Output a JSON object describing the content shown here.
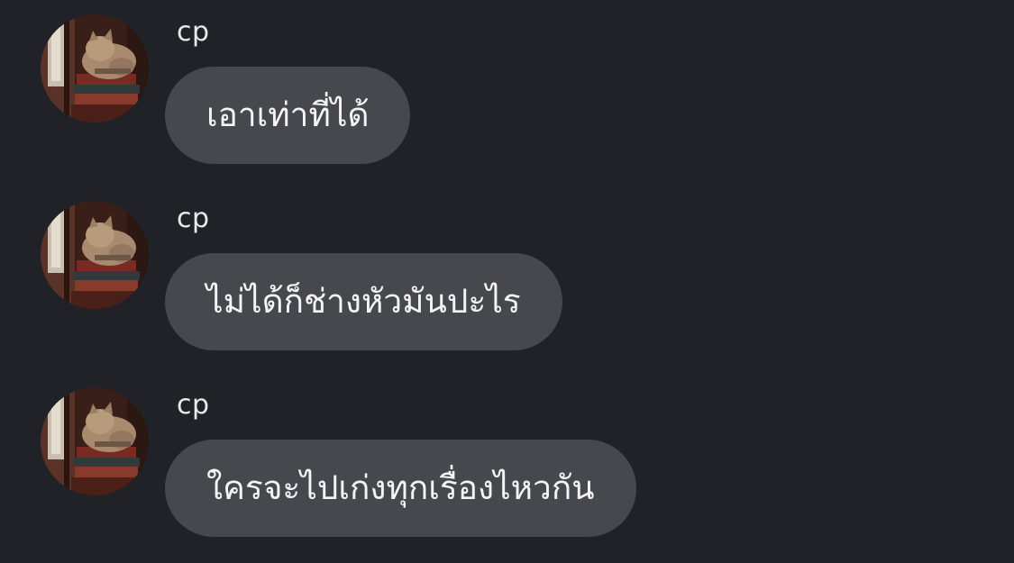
{
  "messages": [
    {
      "sender": "cp",
      "text": "เอาเท่าที่ได้"
    },
    {
      "sender": "cp",
      "text": "ไม่ได้ก็ช่างหัวมันปะไร"
    },
    {
      "sender": "cp",
      "text": "ใครจะไปเก่งทุกเรื่องไหวกัน"
    }
  ],
  "colors": {
    "background": "#212227",
    "bubble": "#47484e",
    "text": "#f4f4f6"
  }
}
